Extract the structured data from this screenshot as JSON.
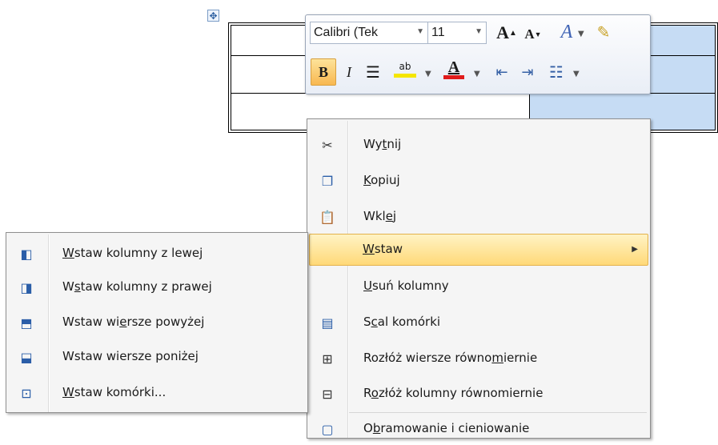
{
  "mini_toolbar": {
    "font_name": "Calibri (Tek",
    "font_size": "11",
    "grow_font_label": "A",
    "shrink_font_label": "A",
    "bold_label": "B",
    "italic_label": "I",
    "highlight_label": "ab",
    "font_color_label": "A",
    "highlight_color": "#f5e600",
    "font_color": "#e01b1b"
  },
  "context_menu": {
    "items": [
      {
        "pre": "Wy",
        "ul": "t",
        "post": "nij",
        "icon": "scissors-icon"
      },
      {
        "pre": "",
        "ul": "K",
        "post": "opiuj",
        "icon": "copy-icon"
      },
      {
        "pre": "Wkl",
        "ul": "e",
        "post": "j",
        "icon": "paste-icon"
      },
      {
        "pre": "",
        "ul": "W",
        "post": "staw",
        "icon": "",
        "highlighted": true,
        "submenu": true
      },
      {
        "pre": "",
        "ul": "U",
        "post": "suń kolumny",
        "icon": ""
      },
      {
        "pre": "S",
        "ul": "c",
        "post": "al komórki",
        "icon": "merge-cells-icon"
      },
      {
        "pre": "Rozłóż wiersze równo",
        "ul": "m",
        "post": "iernie",
        "icon": "distribute-rows-icon"
      },
      {
        "pre": "R",
        "ul": "o",
        "post": "złóż kolumny równomiernie",
        "icon": "distribute-columns-icon"
      },
      {
        "pre": "O",
        "ul": "b",
        "post": "ramowanie i cieniowanie",
        "icon": "borders-shading-icon"
      }
    ]
  },
  "submenu": {
    "items": [
      {
        "pre": "",
        "ul": "W",
        "post": "staw kolumny z lewej",
        "icon": "insert-column-left-icon"
      },
      {
        "pre": "W",
        "ul": "s",
        "post": "taw kolumny z prawej",
        "icon": "insert-column-right-icon"
      },
      {
        "pre": "Wstaw wi",
        "ul": "e",
        "post": "rsze powyżej",
        "icon": "insert-row-above-icon"
      },
      {
        "pre": "Wstaw wiersze poniże",
        "ul": "j",
        "post": "",
        "icon": "insert-row-below-icon"
      },
      {
        "pre": "",
        "ul": "W",
        "post": "staw komórki...",
        "icon": "insert-cells-icon"
      }
    ]
  },
  "colors": {
    "highlight_bg": "#ffd978",
    "menu_bg": "#f5f5f5",
    "table_selection": "#c6dcf4"
  }
}
